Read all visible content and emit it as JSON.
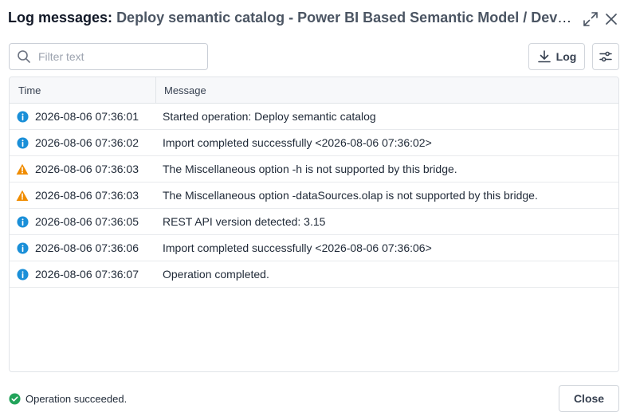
{
  "dialog": {
    "title_label": "Log messages:",
    "title_subject": "Deploy semantic catalog - Power BI Based Semantic Model / Development"
  },
  "toolbar": {
    "search_placeholder": "Filter text",
    "log_label": "Log"
  },
  "table": {
    "columns": [
      "Time",
      "Message"
    ],
    "rows": [
      {
        "level": "info",
        "time": "2026-08-06 07:36:01",
        "message": "Started operation: Deploy semantic catalog"
      },
      {
        "level": "info",
        "time": "2026-08-06 07:36:02",
        "message": "Import completed successfully <2026-08-06 07:36:02>"
      },
      {
        "level": "warning",
        "time": "2026-08-06 07:36:03",
        "message": "The Miscellaneous option -h is not supported by this bridge."
      },
      {
        "level": "warning",
        "time": "2026-08-06 07:36:03",
        "message": "The Miscellaneous option -dataSources.olap is not supported by this bridge."
      },
      {
        "level": "info",
        "time": "2026-08-06 07:36:05",
        "message": "REST API version detected: 3.15"
      },
      {
        "level": "info",
        "time": "2026-08-06 07:36:06",
        "message": "Import completed successfully <2026-08-06 07:36:06>"
      },
      {
        "level": "info",
        "time": "2026-08-06 07:36:07",
        "message": "Operation completed."
      }
    ]
  },
  "footer": {
    "status": "Operation succeeded.",
    "close_label": "Close"
  },
  "colors": {
    "info": "#1a8fd8",
    "warning": "#f08c00",
    "success": "#22a35a"
  }
}
